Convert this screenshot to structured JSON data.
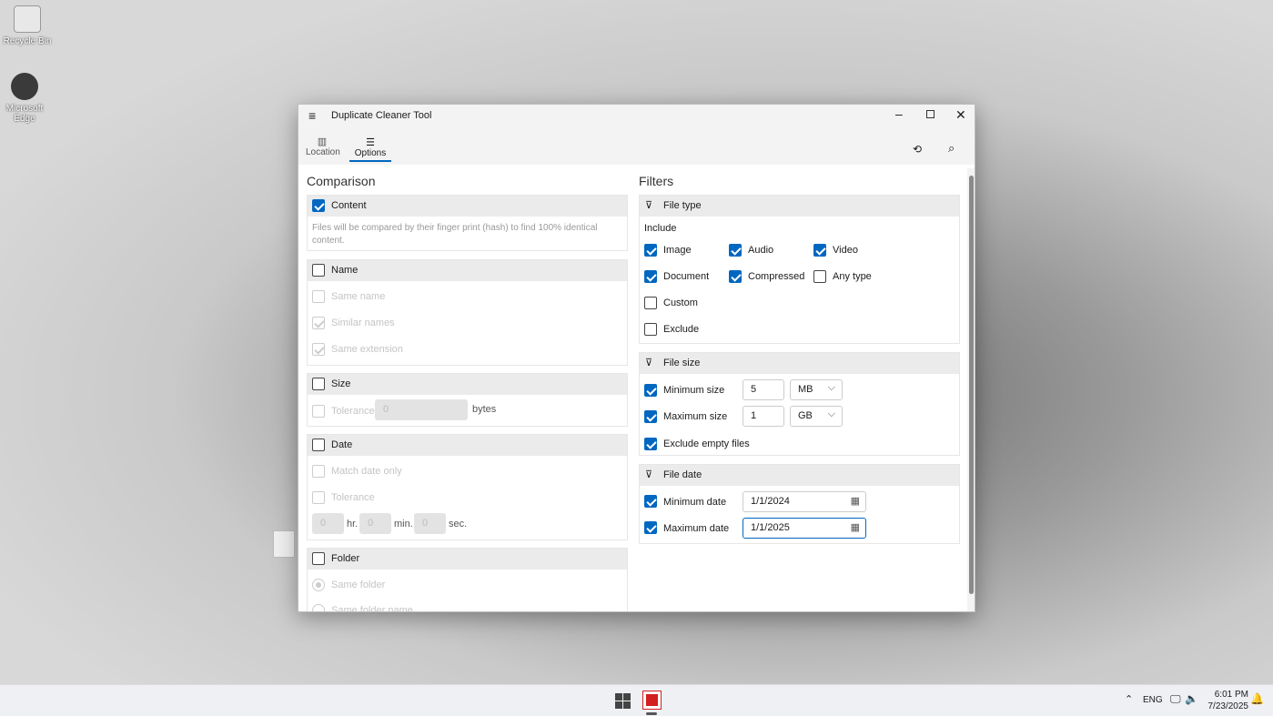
{
  "desktop": {
    "icons": [
      {
        "label": "Recycle Bin"
      },
      {
        "label": "Microsoft Edge"
      }
    ]
  },
  "window": {
    "title": "Duplicate Cleaner Tool",
    "tabs": [
      {
        "label": "Location"
      },
      {
        "label": "Options"
      }
    ]
  },
  "comparison": {
    "heading": "Comparison",
    "content": {
      "label": "Content",
      "checked": true,
      "description": "Files will be compared by their finger print (hash) to find 100% identical content."
    },
    "name": {
      "label": "Name",
      "options": [
        "Same name",
        "Similar names",
        "Same extension"
      ]
    },
    "size": {
      "label": "Size",
      "tolerance": "Tolerance",
      "value": "0",
      "unit": "bytes"
    },
    "date": {
      "label": "Date",
      "match": "Match date only",
      "tolerance": "Tolerance",
      "hr": "0",
      "hr_label": "hr.",
      "min": "0",
      "min_label": "min.",
      "sec": "0",
      "sec_label": "sec."
    },
    "folder": {
      "label": "Folder",
      "options": [
        "Same folder",
        "Same folder name"
      ]
    }
  },
  "filters": {
    "heading": "Filters",
    "file_type": {
      "label": "File type",
      "include": "Include",
      "types": [
        "Image",
        "Audio",
        "Video",
        "Document",
        "Compressed",
        "Any type",
        "Custom",
        "Exclude"
      ]
    },
    "file_size": {
      "label": "File size",
      "min_label": "Minimum size",
      "min_value": "5",
      "min_unit": "MB",
      "max_label": "Maximum size",
      "max_value": "1",
      "max_unit": "GB",
      "exclude_empty": "Exclude empty files"
    },
    "file_date": {
      "label": "File date",
      "min_label": "Minimum date",
      "min_value": "1/1/2024",
      "max_label": "Maximum date",
      "max_value": "1/1/2025"
    }
  },
  "tray": {
    "lang": "ENG",
    "time": "6:01 PM",
    "date": "7/23/2025"
  }
}
